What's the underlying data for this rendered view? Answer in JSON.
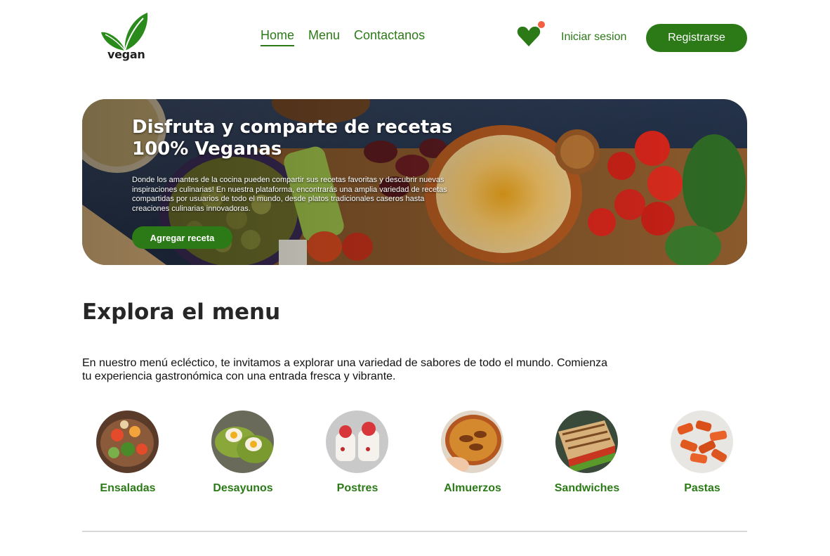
{
  "brand": {
    "logo_text": "vegan"
  },
  "nav": {
    "items": [
      {
        "label": "Home",
        "active": true
      },
      {
        "label": "Menu",
        "active": false
      },
      {
        "label": "Contactanos",
        "active": false
      }
    ]
  },
  "header": {
    "favorites_icon": "heart-icon",
    "login_label": "Iniciar sesion",
    "register_label": "Registrarse"
  },
  "hero": {
    "title": "Disfruta y comparte de recetas 100% Veganas",
    "description": "Donde los amantes de la cocina pueden compartir sus recetas favoritas y descubrir nuevas inspiraciones culinarias! En nuestra plataforma, encontrarás una amplia variedad de recetas compartidas por usuarios de todo el mundo, desde platos tradicionales caseros hasta creaciones culinarias innovadoras.",
    "button_label": "Agregar receta"
  },
  "menu_section": {
    "title": "Explora el menu",
    "description": "En nuestro menú ecléctico, te invitamos a explorar una variedad de sabores de todo el mundo. Comienza tu experiencia gastronómica con una entrada fresca y vibrante.",
    "categories": [
      {
        "label": "Ensaladas"
      },
      {
        "label": "Desayunos"
      },
      {
        "label": "Postres"
      },
      {
        "label": "Almuerzos"
      },
      {
        "label": "Sandwiches"
      },
      {
        "label": "Pastas"
      }
    ]
  },
  "colors": {
    "accent": "#2b7a17",
    "notification": "#f2603f"
  }
}
